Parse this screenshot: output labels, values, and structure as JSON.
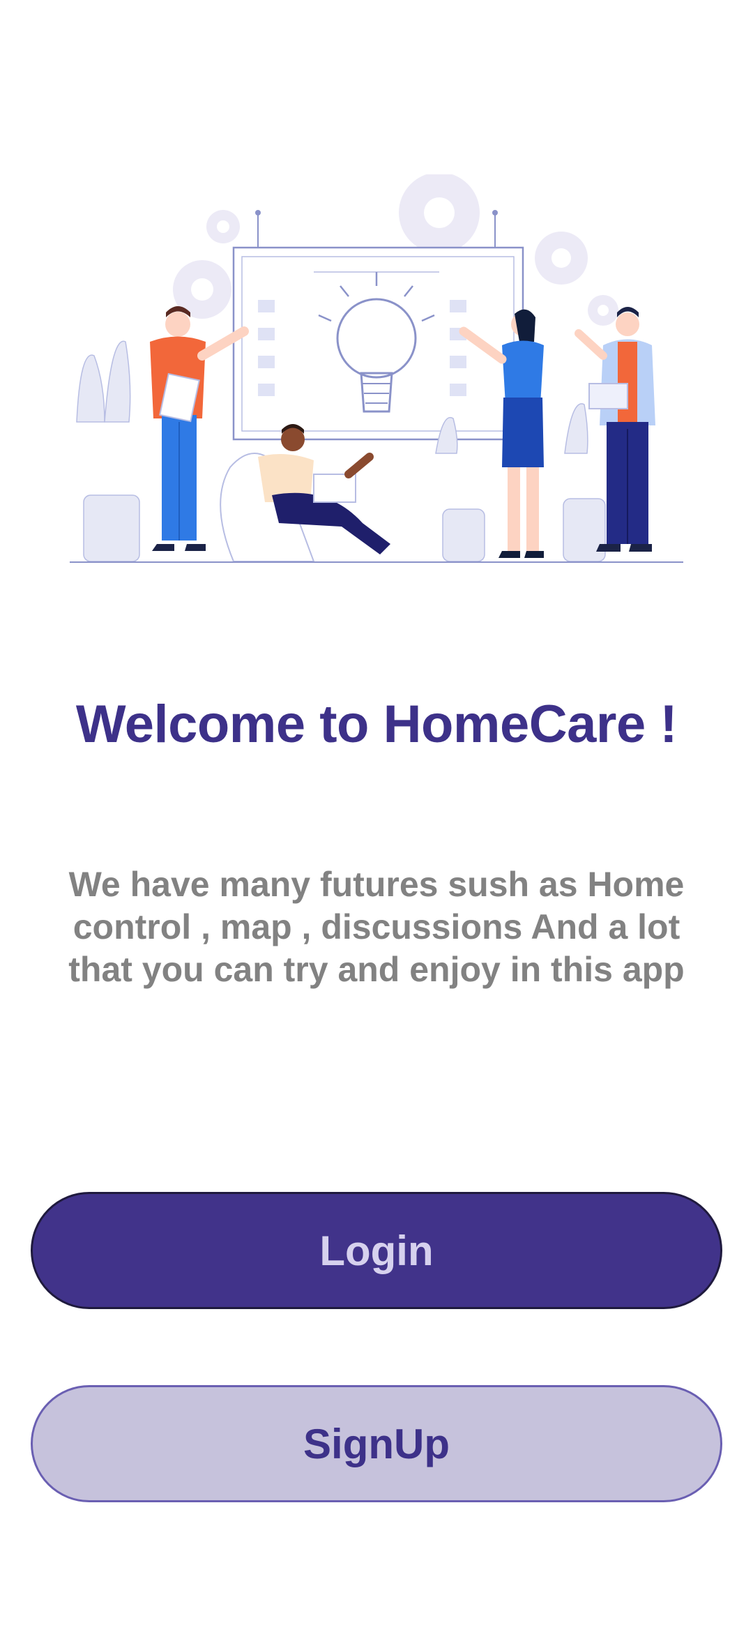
{
  "welcome": {
    "title": "Welcome to HomeCare !",
    "description": "We have many futures  sush as Home control , map , discussions And a lot that you can try and enjoy in this app"
  },
  "actions": {
    "login_label": "Login",
    "signup_label": "SignUp"
  },
  "hero": {
    "icon": "team-brainstorm-illustration"
  },
  "colors": {
    "primary": "#41338a",
    "primary_text": "#3d3189",
    "secondary_bg": "#c6c2dc",
    "muted_text": "#828282",
    "background": "#ffffff"
  }
}
